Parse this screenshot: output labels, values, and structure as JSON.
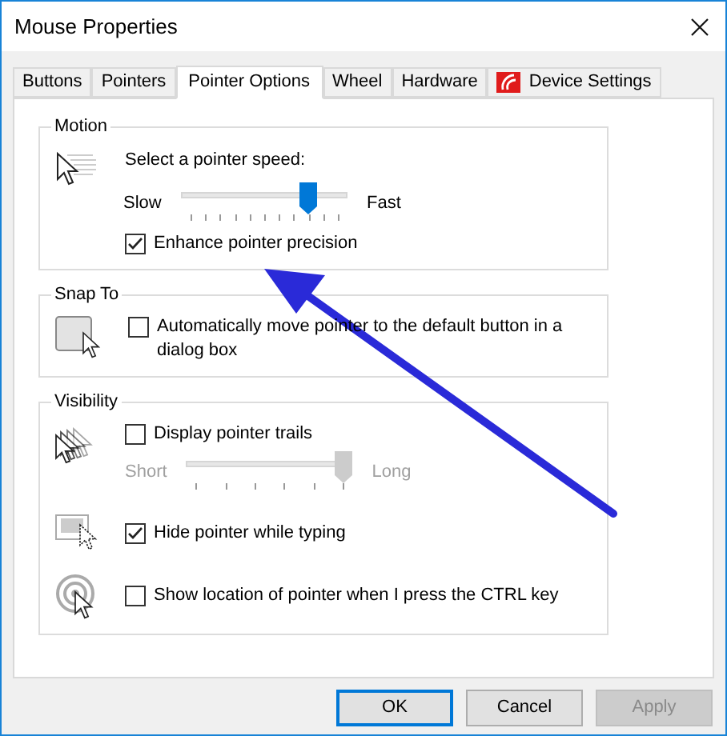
{
  "window": {
    "title": "Mouse Properties"
  },
  "tabs": [
    {
      "label": "Buttons",
      "selected": false,
      "kind": "plain"
    },
    {
      "label": "Pointers",
      "selected": false,
      "kind": "plain"
    },
    {
      "label": "Pointer Options",
      "selected": true,
      "kind": "plain"
    },
    {
      "label": "Wheel",
      "selected": false,
      "kind": "plain"
    },
    {
      "label": "Hardware",
      "selected": false,
      "kind": "plain"
    },
    {
      "label": "Device Settings",
      "selected": false,
      "kind": "device"
    }
  ],
  "motion": {
    "title": "Motion",
    "prompt": "Select a pointer speed:",
    "slow": "Slow",
    "fast": "Fast",
    "speed": {
      "level": 0.8,
      "disabled": false
    },
    "enhance": {
      "label": "Enhance pointer precision",
      "checked": true
    }
  },
  "snap_to": {
    "title": "Snap To",
    "option": {
      "label": "Automatically move pointer to the default button in a dialog box",
      "checked": false
    }
  },
  "visibility": {
    "title": "Visibility",
    "trails": {
      "label": "Display pointer trails",
      "checked": false
    },
    "short": "Short",
    "long": "Long",
    "trail_length": {
      "level": 1,
      "disabled": true
    },
    "hide_typing": {
      "label": "Hide pointer while typing",
      "checked": true
    },
    "show_location": {
      "label": "Show location of pointer when I press the CTRL key",
      "checked": false
    }
  },
  "buttons": [
    {
      "label": "OK",
      "default": true,
      "disabled": false
    },
    {
      "label": "Cancel",
      "default": false,
      "disabled": false
    },
    {
      "label": "Apply",
      "default": false,
      "disabled": true
    }
  ]
}
